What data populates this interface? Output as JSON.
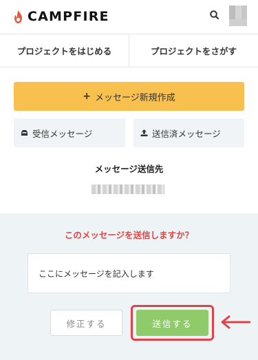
{
  "header": {
    "logo_text": "CAMPFIRE",
    "brand_color": "#e85a3a",
    "search_icon": "search-icon",
    "avatar_icon": "avatar"
  },
  "nav": {
    "items": [
      {
        "label": "プロジェクトをはじめる"
      },
      {
        "label": "プロジェクトをさがす"
      }
    ]
  },
  "actions": {
    "new_message_icon": "+",
    "new_message_label": "メッセージ新規作成",
    "inbox_label": "受信メッセージ",
    "sent_label": "送信済メッセージ",
    "accent_color": "#f8c04f"
  },
  "destination": {
    "title": "メッセージ送信先"
  },
  "confirm": {
    "question": "このメッセージを送信しますか？",
    "message_body": "ここにメッセージを記入します",
    "edit_label": "修正する",
    "send_label": "送信する",
    "send_color": "#8fcb6b",
    "highlight_color": "#e0424a"
  }
}
